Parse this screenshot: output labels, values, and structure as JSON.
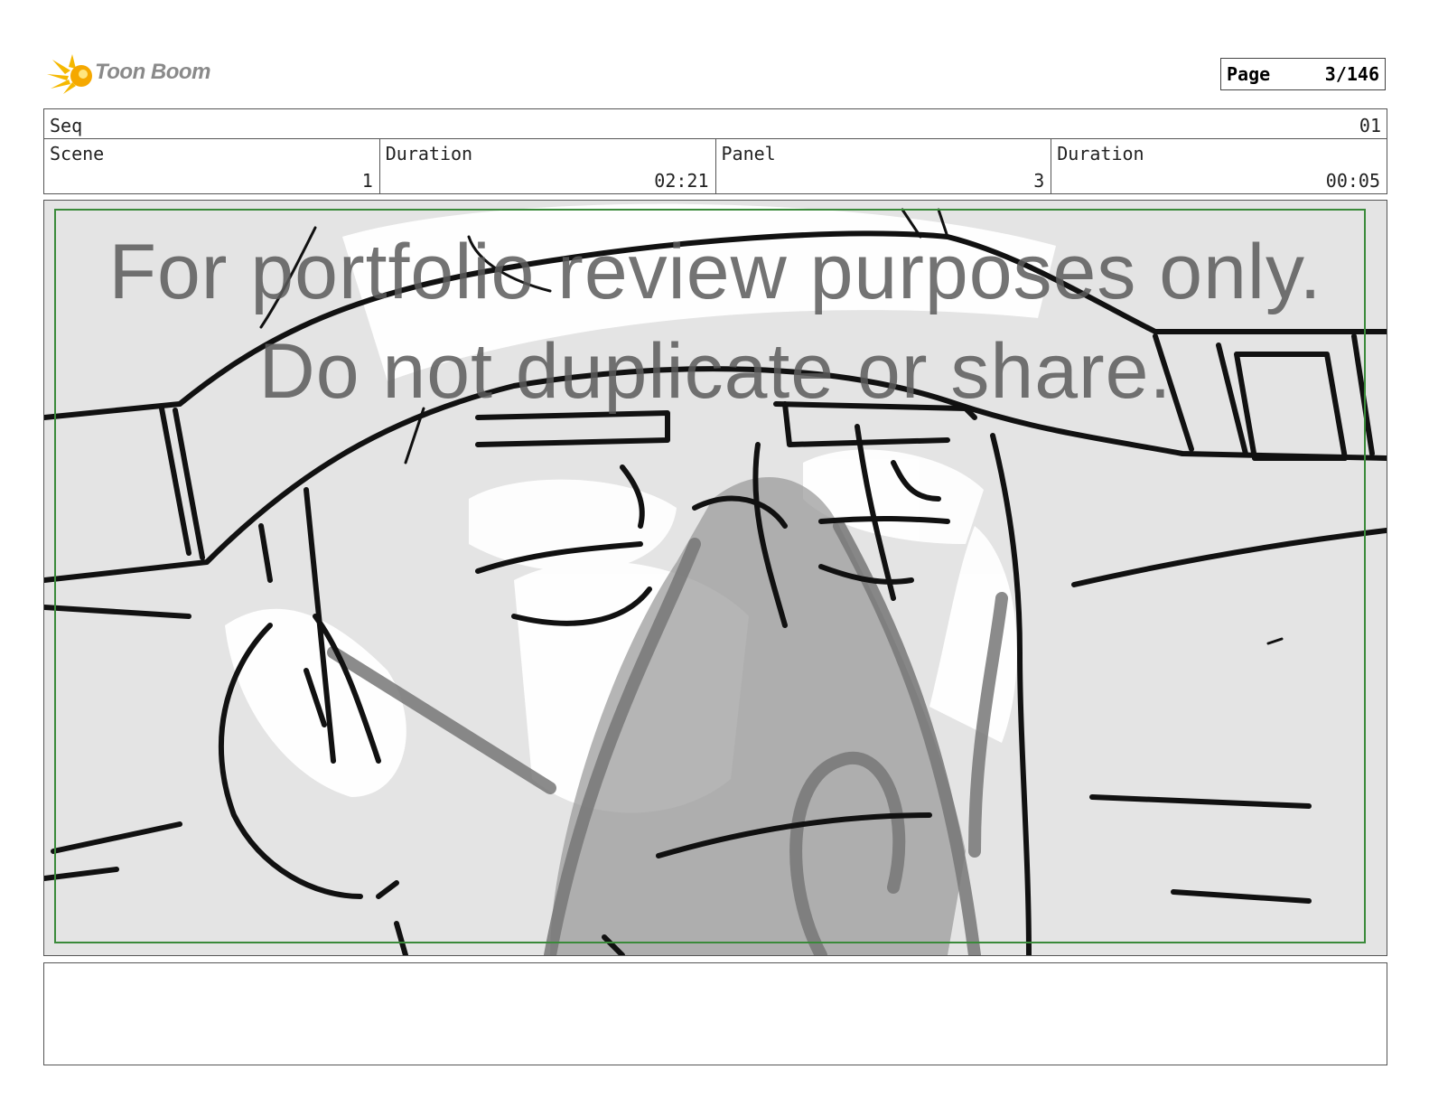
{
  "header": {
    "logo_text": "Toon Boom",
    "page_label": "Page",
    "page_value": "3/146"
  },
  "info": {
    "seq_label": "Seq",
    "seq_value": "01",
    "scene_label": "Scene",
    "scene_value": "1",
    "scene_duration_label": "Duration",
    "scene_duration_value": "02:21",
    "panel_label": "Panel",
    "panel_value": "3",
    "panel_duration_label": "Duration",
    "panel_duration_value": "00:05"
  },
  "panel": {
    "watermark_line1": "For portfolio review purposes only.",
    "watermark_line2": "Do not duplicate or share.",
    "safe_area_color": "#3a8a3a"
  },
  "notes": {
    "text": ""
  }
}
